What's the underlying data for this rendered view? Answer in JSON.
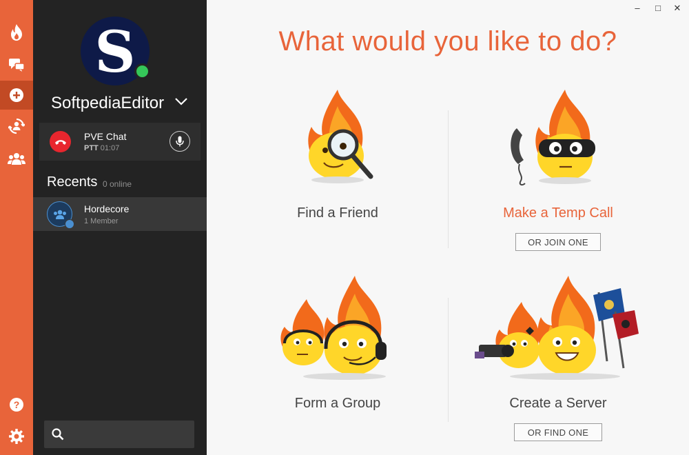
{
  "window": {
    "minimize": "–",
    "maximize": "□",
    "close": "✕"
  },
  "rail": {
    "icons": [
      "flame-icon",
      "chat-icon",
      "add-icon",
      "friends-sync-icon",
      "groups-icon",
      "help-icon",
      "settings-icon"
    ],
    "accent": "#e8643a",
    "active_bg": "#c24a24"
  },
  "profile": {
    "avatar_letter": "S",
    "username": "SoftpediaEditor",
    "status_color": "#35c759"
  },
  "call": {
    "name": "PVE Chat",
    "mode": "PTT",
    "duration": "01:07"
  },
  "recents": {
    "title": "Recents",
    "online": "0 online",
    "items": [
      {
        "name": "Hordecore",
        "members": "1 Member"
      }
    ]
  },
  "search": {
    "placeholder": ""
  },
  "main": {
    "title": "What would you like to do?",
    "cards": [
      {
        "label": "Find a Friend"
      },
      {
        "label": "Make a Temp Call",
        "button": "OR JOIN ONE"
      },
      {
        "label": "Form a Group"
      },
      {
        "label": "Create a Server",
        "button": "OR FIND ONE"
      }
    ]
  }
}
